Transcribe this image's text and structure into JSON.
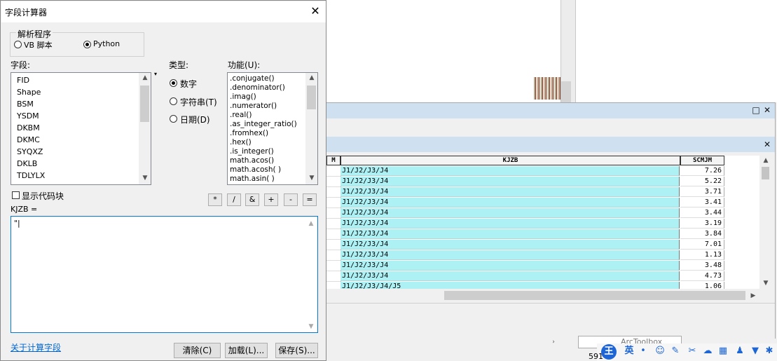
{
  "dialog": {
    "title": "字段计算器",
    "parser_group": "解析程序",
    "parser_options": [
      "VB 脚本",
      "Python"
    ],
    "parser_selected": "Python",
    "fields_label": "字段:",
    "fields": [
      "FID",
      "Shape",
      "BSM",
      "YSDM",
      "DKBM",
      "DKMC",
      "SYQXZ",
      "DKLB",
      "TDLYLX"
    ],
    "type_label": "类型:",
    "types": [
      "数字",
      "字符串(T)",
      "日期(D)"
    ],
    "type_selected": "数字",
    "functions_label": "功能(U):",
    "functions": [
      ".conjugate()",
      ".denominator()",
      ".imag()",
      ".numerator()",
      ".real()",
      ".as_integer_ratio()",
      ".fromhex()",
      ".hex()",
      ".is_integer()",
      "math.acos()",
      "math.acosh( )",
      "math.asin( )"
    ],
    "show_codeblock_label": "显示代码块",
    "operators": [
      "*",
      "/",
      "&",
      "+",
      "-",
      "="
    ],
    "expression_label": "KJZB =",
    "expression_value": "\"|",
    "about_link": "关于计算字段",
    "buttons": {
      "clear": "清除(C)",
      "load": "加载(L)...",
      "save": "保存(S)..."
    }
  },
  "table": {
    "columns": [
      "M",
      "KJZB",
      "SCMJM"
    ],
    "rows": [
      {
        "kjzb": "J1/J2/J3/J4",
        "scmjm": "7.26"
      },
      {
        "kjzb": "J1/J2/J3/J4",
        "scmjm": "5.22"
      },
      {
        "kjzb": "J1/J2/J3/J4",
        "scmjm": "3.71"
      },
      {
        "kjzb": "J1/J2/J3/J4",
        "scmjm": "3.41"
      },
      {
        "kjzb": "J1/J2/J3/J4",
        "scmjm": "3.44"
      },
      {
        "kjzb": "J1/J2/J3/J4",
        "scmjm": "3.19"
      },
      {
        "kjzb": "J1/J2/J3/J4",
        "scmjm": "3.84"
      },
      {
        "kjzb": "J1/J2/J3/J4",
        "scmjm": "7.01"
      },
      {
        "kjzb": "J1/J2/J3/J4",
        "scmjm": "1.13"
      },
      {
        "kjzb": "J1/J2/J3/J4",
        "scmjm": "3.48"
      },
      {
        "kjzb": "J1/J2/J3/J4",
        "scmjm": "4.73"
      },
      {
        "kjzb": "J1/J2/J3/J4/J5",
        "scmjm": "1.06"
      }
    ]
  },
  "taskbar": {
    "arctoolbox_tab": "ArcToolbox",
    "status_number": "591",
    "ime_label": "王",
    "lang_label": "英"
  },
  "icons": [
    "close-icon",
    "maximize-icon",
    "scroll-up-icon",
    "scroll-down-icon",
    "ime-icon"
  ],
  "colors": {
    "kjzb_cell": "#aef1f5",
    "title_band": "#cfe0f1",
    "link": "#0066cc",
    "focus_border": "#0078d7"
  }
}
